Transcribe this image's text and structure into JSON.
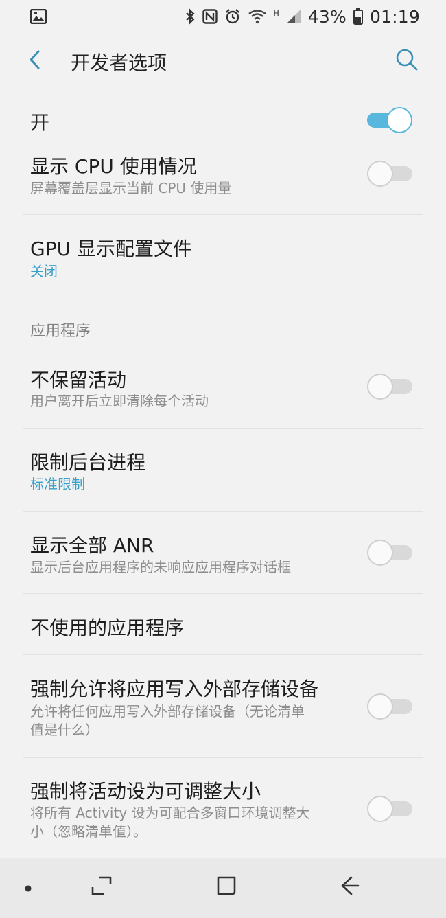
{
  "status_bar": {
    "network_small": "H",
    "battery": "43%",
    "time": "01:19",
    "icons": [
      "gallery-icon",
      "bluetooth-icon",
      "nfc-icon",
      "alarm-icon",
      "wifi-icon",
      "signal-icon",
      "battery-icon"
    ]
  },
  "header": {
    "title": "开发者选项",
    "back_icon": "back-arrow-icon",
    "search_icon": "search-icon"
  },
  "master_switch": {
    "label": "开",
    "state": "on"
  },
  "settings": [
    {
      "title": "显示 CPU 使用情况",
      "subtitle": "屏幕覆盖层显示当前 CPU 使用量",
      "toggle": "off"
    },
    {
      "title": "GPU 显示配置文件",
      "subtitle": "关闭",
      "subtitle_accent": true
    }
  ],
  "section": {
    "title": "应用程序"
  },
  "app_settings": [
    {
      "title": "不保留活动",
      "subtitle": "用户离开后立即清除每个活动",
      "toggle": "off"
    },
    {
      "title": "限制后台进程",
      "subtitle": "标准限制",
      "subtitle_accent": true
    },
    {
      "title": "显示全部 ANR",
      "subtitle": "显示后台应用程序的未响应应用程序对话框",
      "toggle": "off"
    },
    {
      "title": "不使用的应用程序"
    },
    {
      "title": "强制允许将应用写入外部存储设备",
      "subtitle_line1": "允许将任何应用写入外部存储设备（无论清单",
      "subtitle_line2": "值是什么）",
      "toggle": "off"
    },
    {
      "title": "强制将活动设为可调整大小",
      "subtitle_line1": "将所有 Activity 设为可配合多窗口环境调整大",
      "subtitle_line2": "小（忽略清单值）。",
      "toggle": "off"
    }
  ],
  "nav_bar": {
    "items": [
      "dot-icon",
      "recents-icon",
      "home-icon",
      "back-icon"
    ]
  },
  "colors": {
    "accent": "#3aa0c8",
    "toggle_on": "#57b7dd",
    "background": "#f2f2f2"
  }
}
